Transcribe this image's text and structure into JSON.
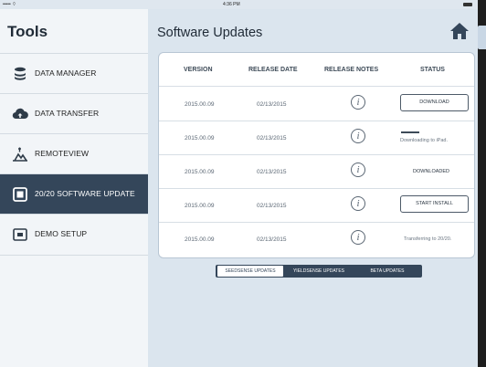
{
  "status_bar": {
    "left": "••••• ⌔",
    "time": "4:36 PM"
  },
  "sidebar": {
    "title": "Tools",
    "items": [
      {
        "label": "DATA MANAGER",
        "icon": "database-icon"
      },
      {
        "label": "DATA TRANSFER",
        "icon": "cloud-upload-icon"
      },
      {
        "label": "REMOTEVIEW",
        "icon": "remote-view-icon"
      },
      {
        "label": "20/20 SOFTWARE UPDATE",
        "icon": "software-update-icon",
        "active": true
      },
      {
        "label": "DEMO SETUP",
        "icon": "demo-setup-icon"
      }
    ]
  },
  "main": {
    "title": "Software Updates",
    "home_icon": "home-icon",
    "table": {
      "headers": [
        "VERSION",
        "RELEASE DATE",
        "RELEASE NOTES",
        "STATUS"
      ],
      "rows": [
        {
          "version": "2015.00.09",
          "date": "02/13/2015",
          "notes": "i",
          "status": "DOWNLOAD",
          "status_type": "button"
        },
        {
          "version": "2015.00.09",
          "date": "02/13/2015",
          "notes": "i",
          "status": "Downloading to iPad.",
          "status_type": "progress"
        },
        {
          "version": "2015.00.09",
          "date": "02/13/2015",
          "notes": "i",
          "status": "DOWNLOADED",
          "status_type": "text"
        },
        {
          "version": "2015.00.09",
          "date": "02/13/2015",
          "notes": "i",
          "status": "START INSTALL",
          "status_type": "button"
        },
        {
          "version": "2015.00.09",
          "date": "02/13/2015",
          "notes": "i",
          "status": "Transferring to 20/20.",
          "status_type": "text"
        }
      ]
    },
    "segments": [
      "SEEDSENSE UPDATES",
      "YIELDSENSE UPDATES",
      "BETA UPDATES"
    ],
    "active_segment": 0
  },
  "colors": {
    "accent": "#34465a",
    "background": "#dbe5ee",
    "sidebar": "#f2f5f8"
  }
}
